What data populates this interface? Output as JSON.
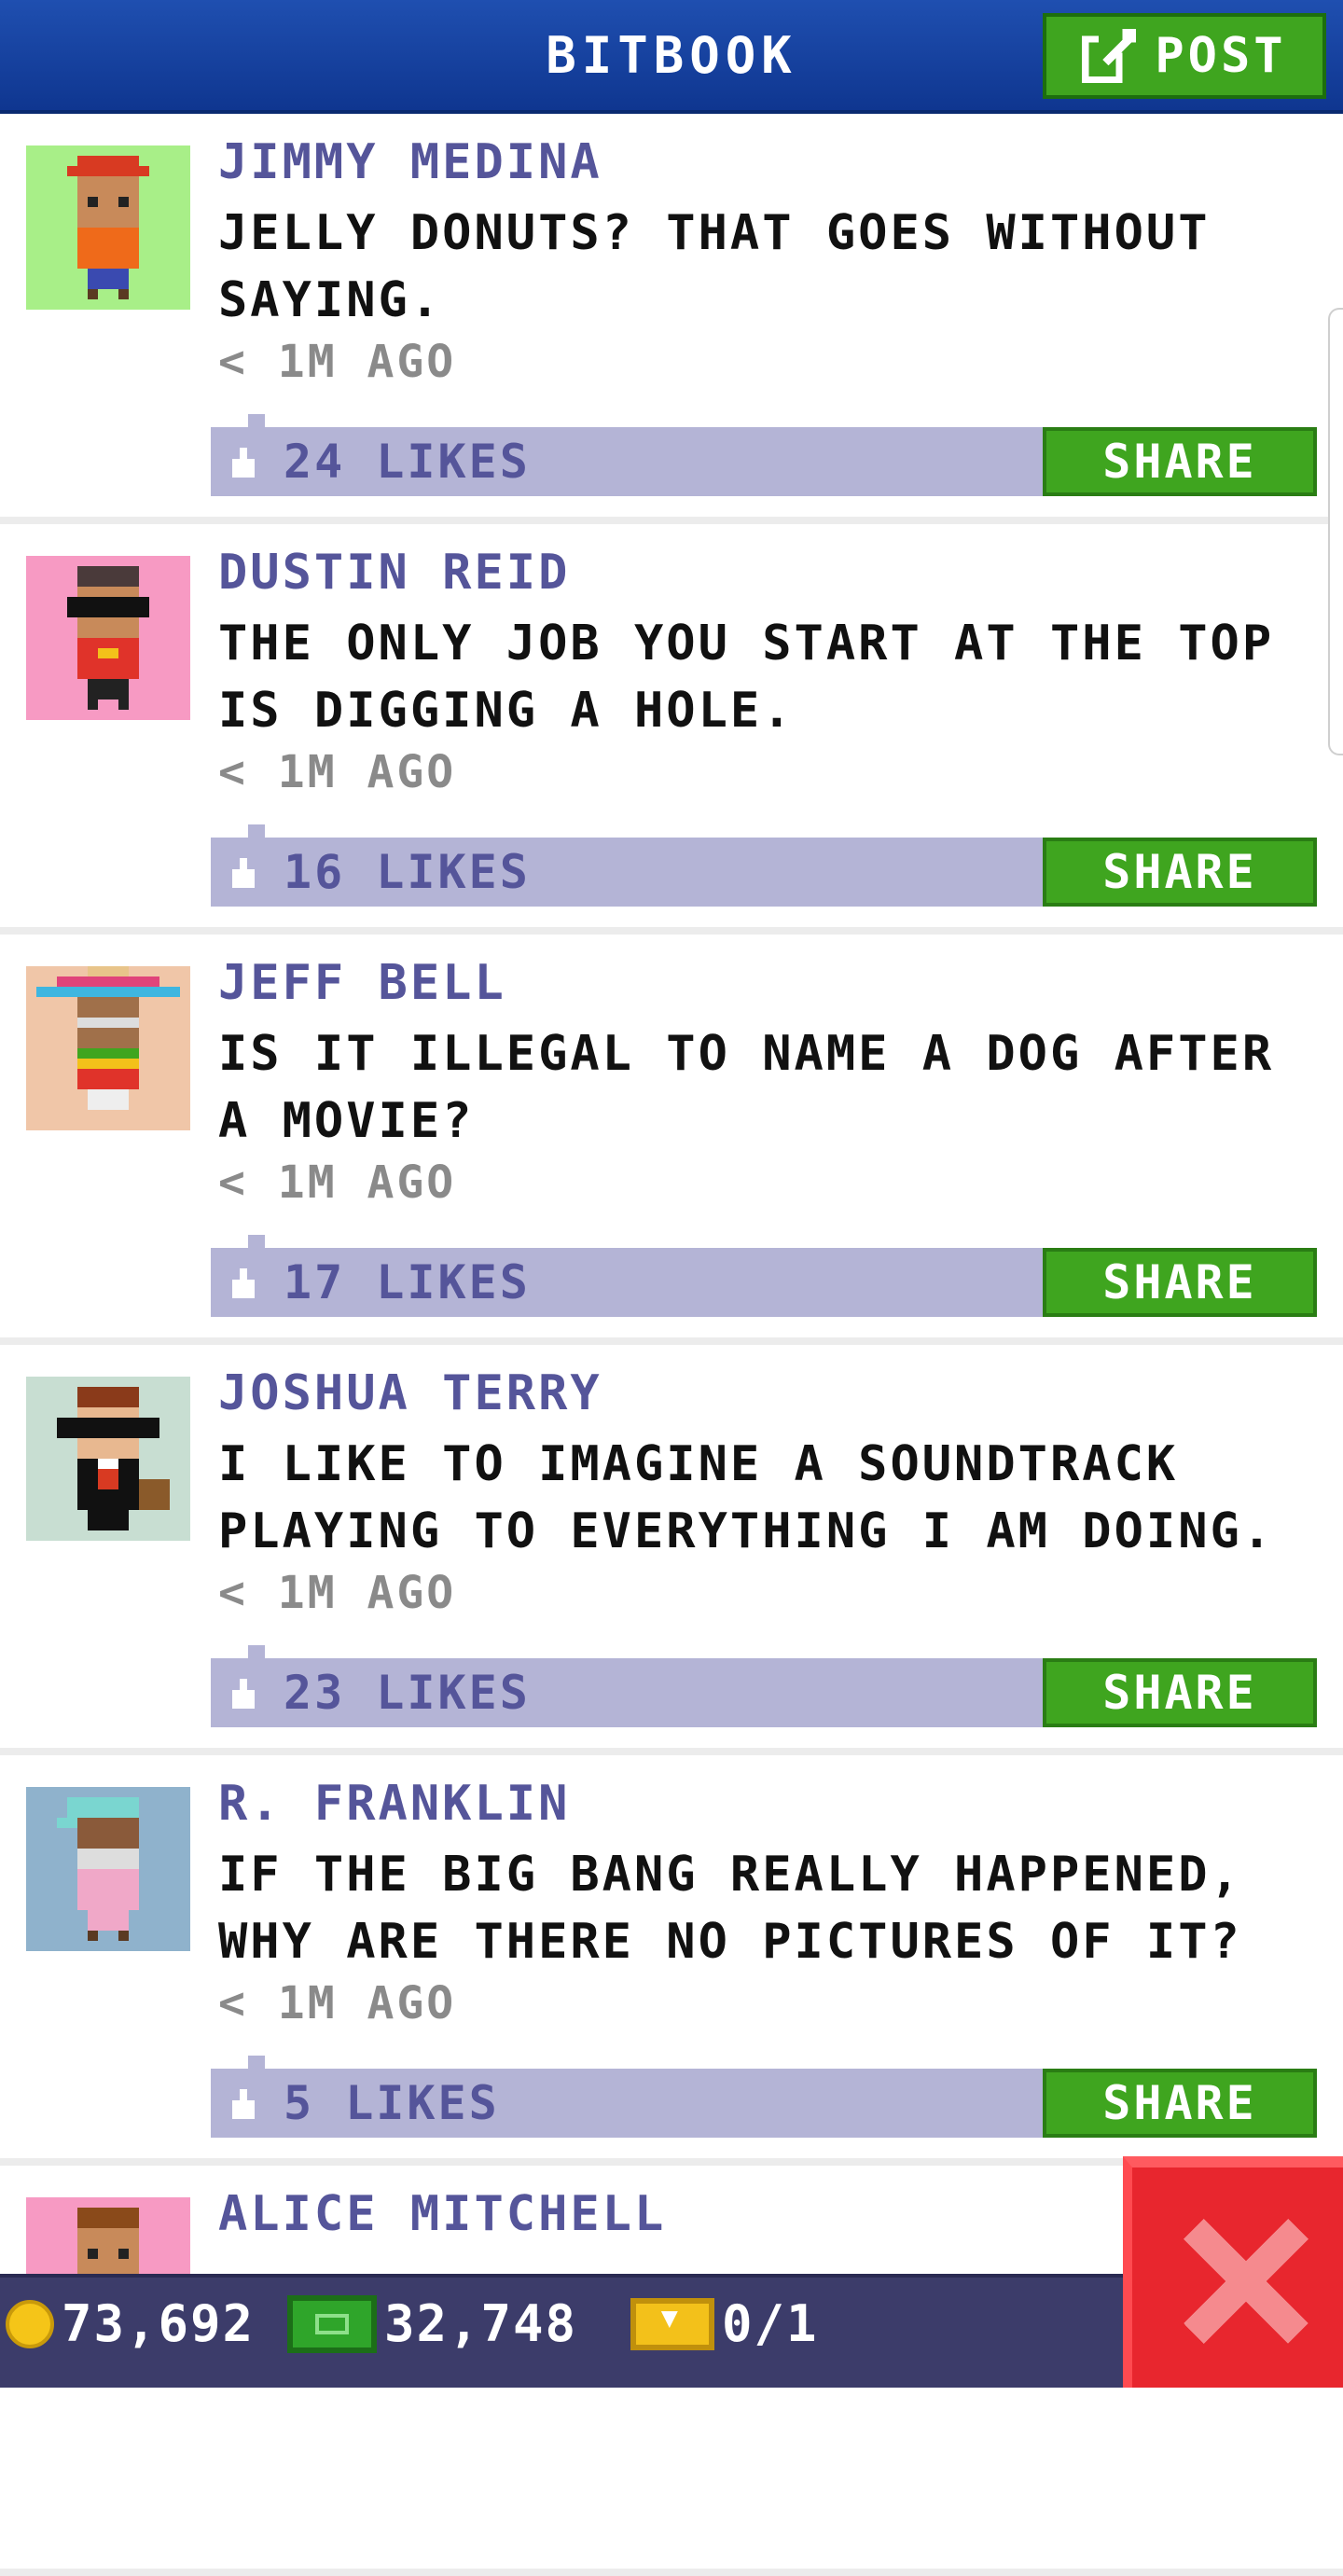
{
  "header": {
    "title": "BITBOOK",
    "post_label": "POST"
  },
  "feed": [
    {
      "author": "JIMMY MEDINA",
      "message": "JELLY DONUTS? THAT GOES WITHOUT SAYING.",
      "time": "< 1M AGO",
      "likes": "24 LIKES",
      "share_label": "SHARE",
      "avatar_bg": "#a8ef88",
      "avatar_icon": "pixel-person-red-cap"
    },
    {
      "author": "DUSTIN REID",
      "message": "THE ONLY JOB YOU START AT THE TOP IS DIGGING A HOLE.",
      "time": "< 1M AGO",
      "likes": "16 LIKES",
      "share_label": "SHARE",
      "avatar_bg": "#f79ac3",
      "avatar_icon": "pixel-person-masked"
    },
    {
      "author": "JEFF BELL",
      "message": "IS IT ILLEGAL TO NAME A DOG AFTER A MOVIE?",
      "time": "< 1M AGO",
      "likes": "17 LIKES",
      "share_label": "SHARE",
      "avatar_bg": "#f0c6a8",
      "avatar_icon": "pixel-person-sombrero"
    },
    {
      "author": "JOSHUA TERRY",
      "message": "I LIKE TO IMAGINE A SOUNDTRACK PLAYING TO EVERYTHING I AM DOING.",
      "time": "< 1M AGO",
      "likes": "23 LIKES",
      "share_label": "SHARE",
      "avatar_bg": "#c8ded2",
      "avatar_icon": "pixel-person-sunglasses-suit"
    },
    {
      "author": "R. FRANKLIN",
      "message": "IF THE BIG BANG REALLY HAPPENED, WHY ARE THERE NO PICTURES OF IT?",
      "time": "< 1M AGO",
      "likes": "5 LIKES",
      "share_label": "SHARE",
      "avatar_bg": "#8fb2cc",
      "avatar_icon": "pixel-person-cyan-cap"
    },
    {
      "author": "ALICE MITCHELL",
      "message": "",
      "time": "",
      "likes": "",
      "share_label": "",
      "avatar_bg": "#f79ac3",
      "avatar_icon": "pixel-person-brown-hair"
    }
  ],
  "bottom_bar": {
    "coins": "73,692",
    "bux": "32,748",
    "tickets": "0/1"
  },
  "colors": {
    "header_blue": "#1f4fb0",
    "share_green": "#3fa51f",
    "likes_bar": "#b4b4d6",
    "author_purple": "#55559a",
    "close_red": "#e8262e",
    "bottom_bar": "#3c3c6a"
  }
}
